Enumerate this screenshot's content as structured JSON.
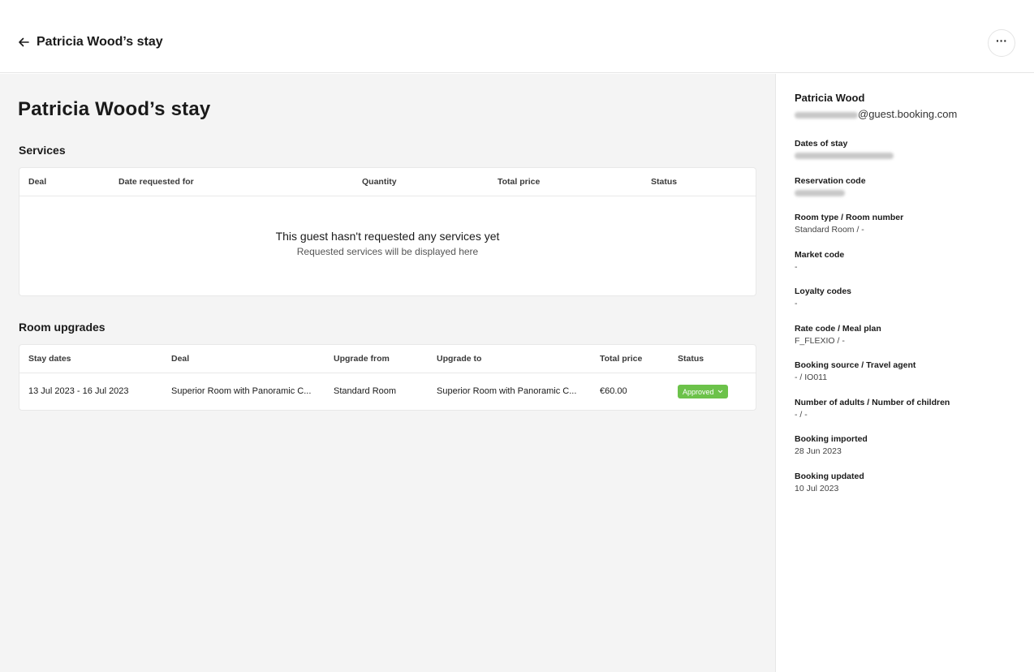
{
  "header": {
    "title": "Patricia Wood’s stay"
  },
  "main": {
    "page_title": "Patricia Wood’s stay",
    "services": {
      "title": "Services",
      "columns": [
        "Deal",
        "Date requested for",
        "Quantity",
        "Total price",
        "Status"
      ],
      "empty_title": "This guest hasn't requested any services yet",
      "empty_subtitle": "Requested services will be displayed here"
    },
    "upgrades": {
      "title": "Room upgrades",
      "columns": [
        "Stay dates",
        "Deal",
        "Upgrade from",
        "Upgrade to",
        "Total price",
        "Status"
      ],
      "rows": [
        {
          "stay_dates": "13 Jul 2023 - 16 Jul 2023",
          "deal": "Superior Room with Panoramic C...",
          "upgrade_from": "Standard Room",
          "upgrade_to": "Superior Room with Panoramic C...",
          "total_price": "€60.00",
          "status": "Approved"
        }
      ]
    }
  },
  "sidebar": {
    "guest_name": "Patricia Wood",
    "email_domain": "@guest.booking.com",
    "fields": [
      {
        "label": "Dates of stay",
        "value": ""
      },
      {
        "label": "Reservation code",
        "value": ""
      },
      {
        "label": "Room type / Room number",
        "value": "Standard Room / -"
      },
      {
        "label": "Market code",
        "value": "-"
      },
      {
        "label": "Loyalty codes",
        "value": "-"
      },
      {
        "label": "Rate code / Meal plan",
        "value": "F_FLEXIO / -"
      },
      {
        "label": "Booking source / Travel agent",
        "value": "- / IO011"
      },
      {
        "label": "Number of adults / Number of children",
        "value": "- / -"
      },
      {
        "label": "Booking imported",
        "value": "28 Jun 2023"
      },
      {
        "label": "Booking updated",
        "value": "10 Jul 2023"
      }
    ]
  },
  "colors": {
    "approved": "#6cc24a",
    "background": "#f4f4f4"
  }
}
